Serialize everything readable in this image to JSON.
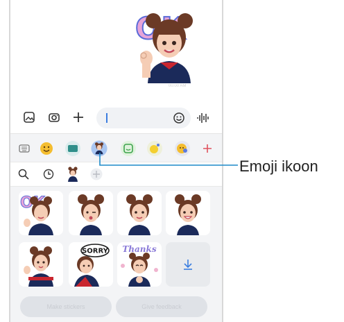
{
  "chat": {
    "sticker_lettering": "OK",
    "timestamp": "00:00 AM"
  },
  "composer": {
    "gallery_icon": "image-icon",
    "camera_icon": "camera-icon",
    "add_icon": "plus-icon",
    "emoji_icon": "smiley-icon",
    "voice_icon": "voice-wave-icon"
  },
  "categories": [
    {
      "name": "keyboard-icon"
    },
    {
      "name": "emoji-icon"
    },
    {
      "name": "gif-icon"
    },
    {
      "name": "ar-emoji-icon",
      "selected": true
    },
    {
      "name": "sticker-icon"
    },
    {
      "name": "bitmoji-icon"
    },
    {
      "name": "mojitok-icon"
    },
    {
      "name": "add-icon"
    }
  ],
  "subtools": [
    "search-icon",
    "recent-icon",
    "avatar-thumb",
    "add-icon"
  ],
  "stickers": {
    "sorry_text": "SORRY",
    "thanks_text": "Thanks",
    "download_icon": "download-icon"
  },
  "buttons": {
    "left": "Make stickers",
    "right": "Give feedback"
  },
  "callout": {
    "label": "Emoji ikoon"
  },
  "colors": {
    "accent": "#3a7de0",
    "callout_line": "#1d8ac9",
    "shirt": "#1b2a5a",
    "hair": "#6b3a26",
    "ok_letters": "#e7a4d8",
    "selected_bg": "#a9c6f2"
  }
}
